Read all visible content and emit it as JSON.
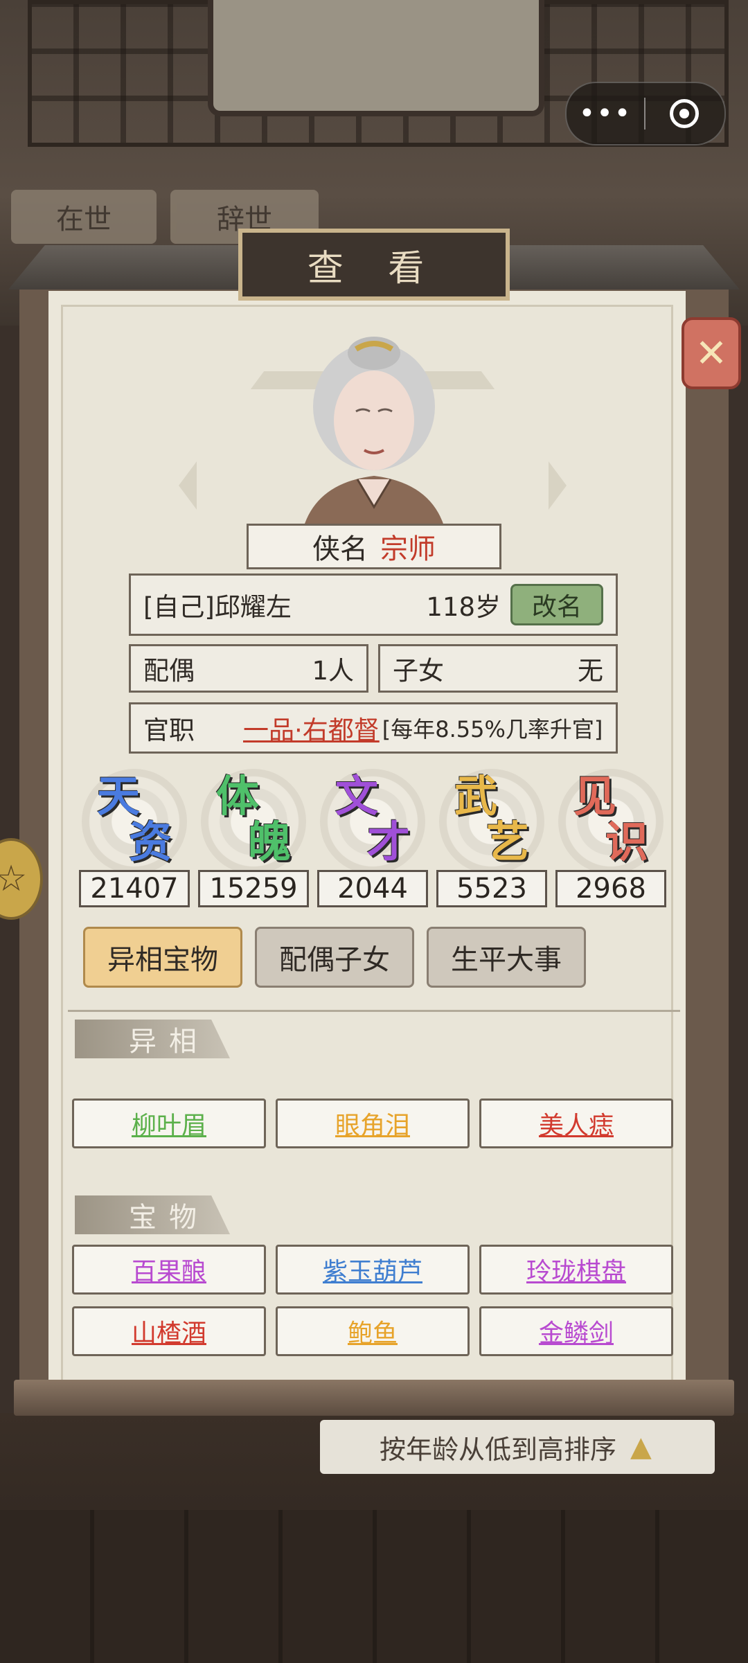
{
  "background": {
    "tabs": [
      "在世",
      "辞世"
    ],
    "sort_label": "按年龄从低到高排序"
  },
  "capsule": {
    "more": "•••",
    "record": "record-icon"
  },
  "panel": {
    "title": "查 看"
  },
  "character": {
    "title_label": "侠名",
    "title_value": "宗师",
    "name": "[自己]邱耀左",
    "age": "118岁",
    "rename_label": "改名",
    "spouse_label": "配偶",
    "spouse_value": "1人",
    "children_label": "子女",
    "children_value": "无",
    "official_label": "官职",
    "official_value": "一品·右都督",
    "official_note": "[每年8.55%几率升官]"
  },
  "stats": [
    {
      "label": "天资",
      "value": "21407",
      "color": "#4a7be0"
    },
    {
      "label": "体魄",
      "value": "15259",
      "color": "#4fc06a"
    },
    {
      "label": "文才",
      "value": "2044",
      "color": "#a050d8"
    },
    {
      "label": "武艺",
      "value": "5523",
      "color": "#e8b84a"
    },
    {
      "label": "见识",
      "value": "2968",
      "color": "#e06a5a"
    }
  ],
  "tabs": [
    {
      "label": "异相宝物",
      "active": true
    },
    {
      "label": "配偶子女",
      "active": false
    },
    {
      "label": "生平大事",
      "active": false
    }
  ],
  "traits": {
    "heading": "异相",
    "items": [
      {
        "label": "柳叶眉",
        "color": "#5bb04a"
      },
      {
        "label": "眼角泪",
        "color": "#e7a32a"
      },
      {
        "label": "美人痣",
        "color": "#d23a2e"
      }
    ]
  },
  "treasures": {
    "heading": "宝物",
    "items": [
      {
        "label": "百果酿",
        "color": "#b84ad0"
      },
      {
        "label": "紫玉葫芦",
        "color": "#3f7ed0"
      },
      {
        "label": "玲珑棋盘",
        "color": "#b84ad0"
      },
      {
        "label": "山楂酒",
        "color": "#d23a2e"
      },
      {
        "label": "鲍鱼",
        "color": "#e7a32a"
      },
      {
        "label": "金鳞剑",
        "color": "#b84ad0"
      }
    ]
  }
}
